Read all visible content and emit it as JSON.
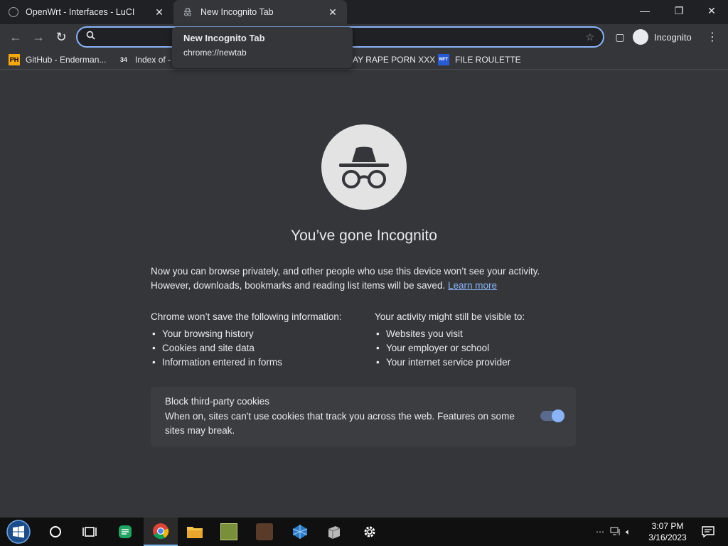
{
  "tabs": [
    {
      "title": "OpenWrt - Interfaces - LuCI",
      "active": false
    },
    {
      "title": "New Incognito Tab",
      "active": true
    }
  ],
  "tooltip": {
    "title": "New Incognito Tab",
    "url": "chrome://newtab"
  },
  "omnibox": {
    "value": ""
  },
  "profile": {
    "label": "Incognito"
  },
  "bookmarks": [
    {
      "label": "GitHub - Enderman...",
      "icon": "PH"
    },
    {
      "label": "Index of -",
      "icon": "34"
    },
    {
      "label": "AY RAPE PORN XXX",
      "icon": ""
    },
    {
      "label": "FILE ROULETTE",
      "icon": "MFT"
    }
  ],
  "incognito": {
    "heading": "You’ve gone Incognito",
    "desc": "Now you can browse privately, and other people who use this device won’t see your activity. However, downloads, bookmarks and reading list items will be saved.",
    "learn_more": "Learn more",
    "left_title_a": "Chrome ",
    "left_title_b": "won’t save",
    "left_title_c": " the following information:",
    "left_items": [
      "Your browsing history",
      "Cookies and site data",
      "Information entered in forms"
    ],
    "right_title_a": "Your activity ",
    "right_title_b": "might still be visible",
    "right_title_c": " to:",
    "right_items": [
      "Websites you visit",
      "Your employer or school",
      "Your internet service provider"
    ],
    "cookie_title": "Block third-party cookies",
    "cookie_desc": "When on, sites can't use cookies that track you across the web. Features on some sites may break.",
    "cookie_enabled": true
  },
  "taskbar": {
    "time": "3:07 PM",
    "date": "3/16/2023"
  },
  "colors": {
    "accent": "#8ab4f8",
    "bg": "#35363a",
    "tabstrip": "#202124"
  }
}
